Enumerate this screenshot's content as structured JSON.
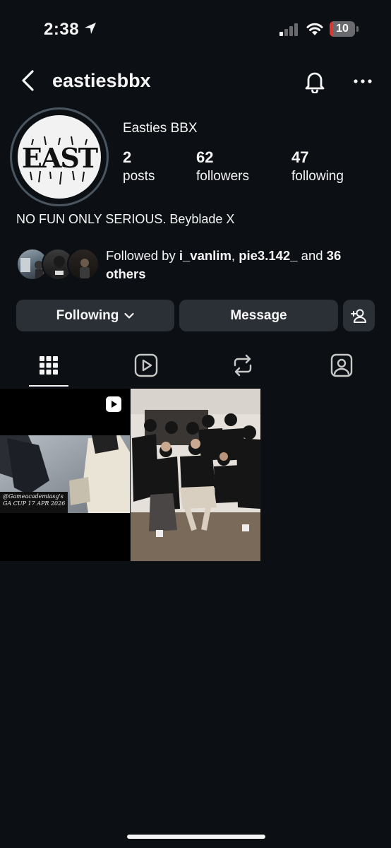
{
  "status": {
    "time": "2:38",
    "battery": "10",
    "battery_level": 0.1
  },
  "header": {
    "username": "eastiesbbx"
  },
  "profile": {
    "display_name": "Easties BBX",
    "avatar_text": "EAST",
    "stats": [
      {
        "value": "2",
        "label": "posts"
      },
      {
        "value": "62",
        "label": "followers"
      },
      {
        "value": "47",
        "label": "following"
      }
    ],
    "bio": "NO FUN ONLY SERIOUS. Beyblade X",
    "followed_by": {
      "prefix": "Followed by ",
      "user1": "i_vanlim",
      "sep": ", ",
      "user2": "pie3.142_",
      "and": " and ",
      "others": "36 others"
    }
  },
  "buttons": {
    "following": "Following",
    "message": "Message"
  },
  "tabs": [
    "grid-icon",
    "reels-icon",
    "reposts-icon",
    "tagged-icon"
  ],
  "posts": [
    {
      "type": "reel",
      "caption_line1": "@Gameacademiasg's",
      "caption_line2": "GA CUP 17 APR 2026"
    },
    {
      "type": "photo"
    }
  ],
  "colors": {
    "background": "#0c1014",
    "button": "#2b3036",
    "battery_low": "#e5332a"
  }
}
